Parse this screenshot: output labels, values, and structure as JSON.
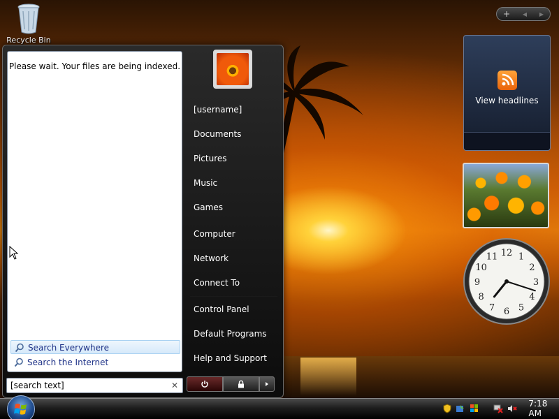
{
  "desktop": {
    "recycle_bin_label": "Recycle Bin"
  },
  "start_menu": {
    "index_message": "Please wait. Your files are being indexed.",
    "search_options": [
      {
        "label": "Search Everywhere",
        "selected": true,
        "icon": "search-icon"
      },
      {
        "label": "Search the Internet",
        "selected": false,
        "icon": "search-icon"
      }
    ],
    "search_value": "[search text]",
    "clear_glyph": "✕",
    "user_name": "[username]",
    "right_items": {
      "documents": "Documents",
      "pictures": "Pictures",
      "music": "Music",
      "games": "Games",
      "computer": "Computer",
      "network": "Network",
      "connect_to": "Connect To",
      "control_panel": "Control Panel",
      "default_programs": "Default Programs",
      "help_support": "Help and Support"
    }
  },
  "sidebar": {
    "controls": [
      "+",
      "◀",
      "▶"
    ],
    "feed_label": "View headlines"
  },
  "clock": {
    "hour": 7,
    "minute": 18
  },
  "taskbar": {
    "time": "7:18 AM"
  },
  "colors": {
    "accent": "#1e3287",
    "rss": "#f07a1a",
    "taskbar": "#1e1e1e"
  }
}
